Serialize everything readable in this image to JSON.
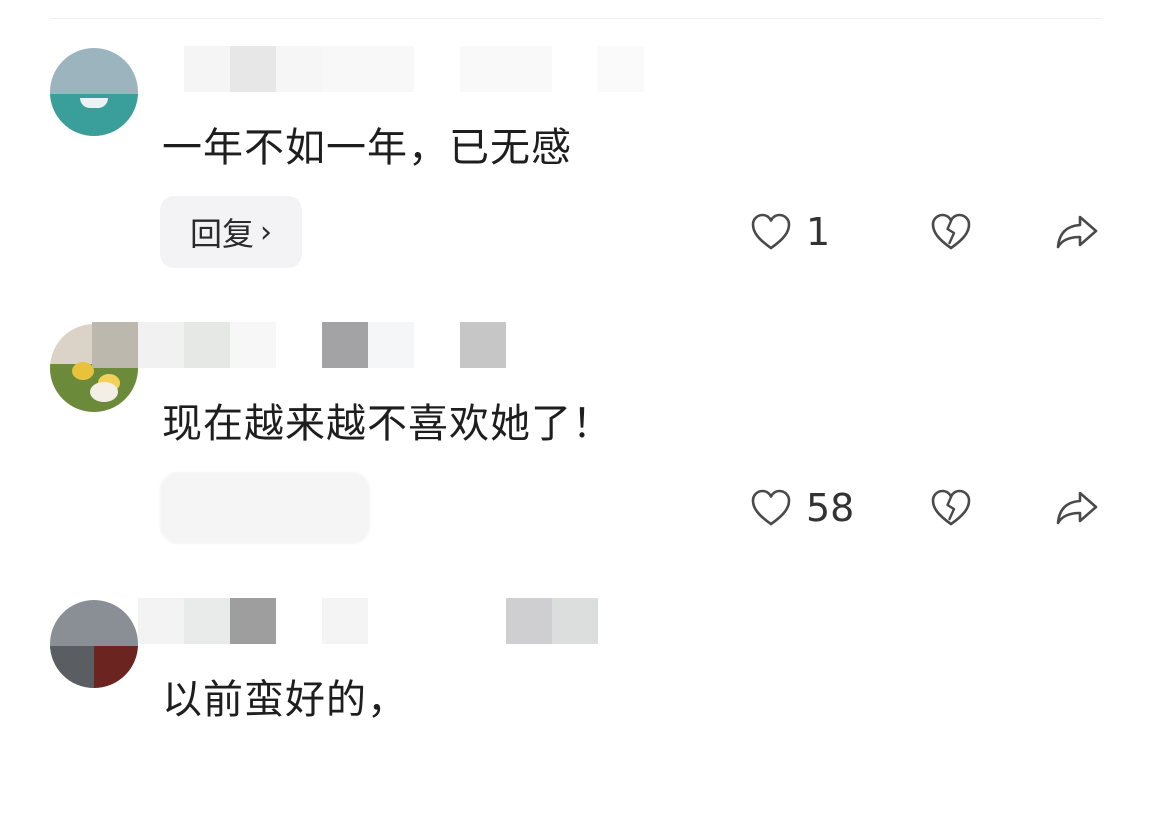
{
  "comments": [
    {
      "text": "一年不如一年，已无感",
      "reply_label": "回复",
      "reply_chevron": "›",
      "like_count": "1",
      "avatar_color": "#3a9e9a"
    },
    {
      "text": "现在越来越不喜欢她了！",
      "reply_label": "",
      "like_count": "58",
      "avatar_color": "#6b8a3a"
    },
    {
      "text": "以前蛮好的，",
      "avatar_color": "#7a7f86"
    }
  ],
  "icons": {
    "like": "heart-outline-icon",
    "dislike": "broken-heart-icon",
    "share": "share-arrow-icon"
  },
  "colors": {
    "icon_stroke": "#4a4a4a",
    "reply_bg": "#f3f3f5",
    "text": "#1e1e1e"
  }
}
